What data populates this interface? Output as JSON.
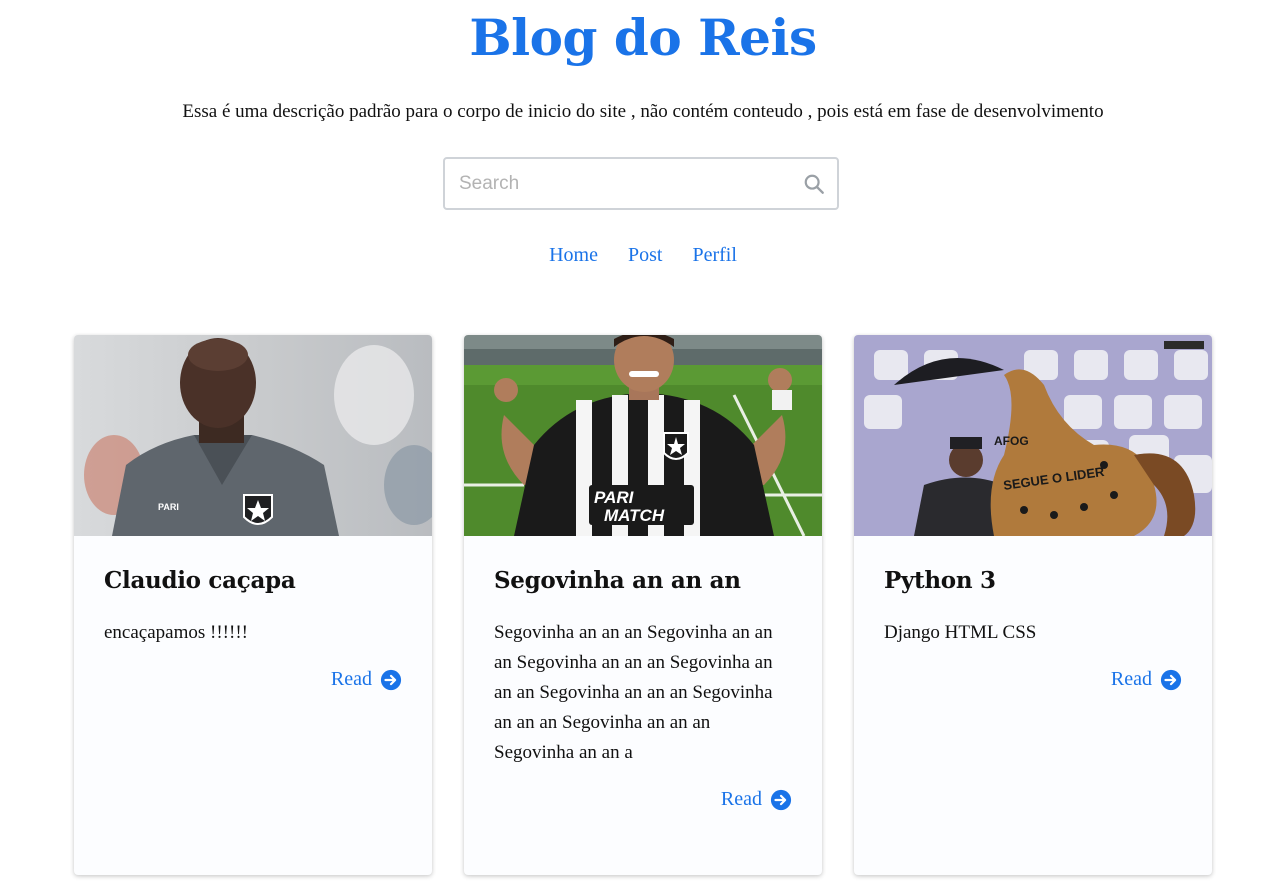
{
  "site": {
    "title": "Blog do Reis",
    "description": "Essa é uma descrição padrão para o corpo de inicio do site , não contém conteudo , pois está em fase de desenvolvimento"
  },
  "search": {
    "placeholder": "Search",
    "value": "",
    "icon": "search-icon"
  },
  "nav": {
    "items": [
      {
        "label": "Home"
      },
      {
        "label": "Post"
      },
      {
        "label": "Perfil"
      }
    ]
  },
  "colors": {
    "accent": "#1a73e8",
    "card_background": "#fcfdff"
  },
  "posts": [
    {
      "title": "Claudio caçapa",
      "text": "encaçapamos !!!!!!",
      "read_label": "Read",
      "image_desc": "man-in-gray-polo-shirt"
    },
    {
      "title": "Segovinha an an an",
      "text": "Segovinha an an an Segovinha an an an Segovinha an an an Segovinha an an an Segovinha an an an Segovinha an an an Segovinha an an an Segovinha an an a",
      "read_label": "Read",
      "image_desc": "player-in-striped-jersey-thumbs-up"
    },
    {
      "title": "Python 3",
      "text": "Django HTML CSS",
      "read_label": "Read",
      "image_desc": "fan-with-horse-statue-in-stadium"
    }
  ]
}
